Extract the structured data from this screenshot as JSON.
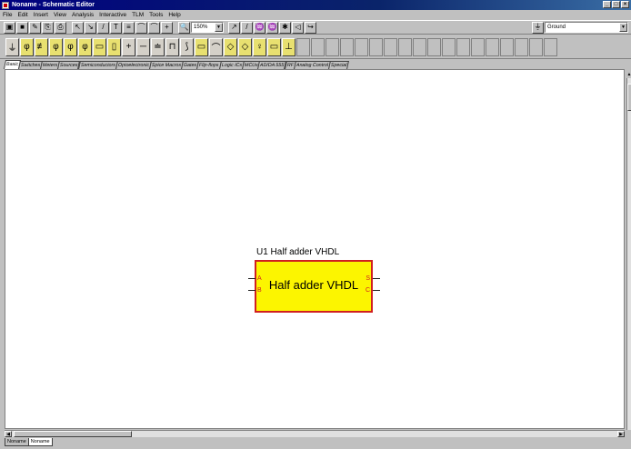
{
  "window": {
    "title": "Noname - Schematic Editor",
    "controls": [
      "_",
      "□",
      "×"
    ]
  },
  "menu": [
    "File",
    "Edit",
    "Insert",
    "View",
    "Analysis",
    "Interactive",
    "TLM",
    "Tools",
    "Help"
  ],
  "toolbar": {
    "buttons_a": [
      "▣",
      "■",
      "✎",
      "⎘",
      "⎙"
    ],
    "buttons_b": [
      "↖",
      "↘",
      "/",
      "T",
      "≡",
      "⌒",
      "⌒",
      "+"
    ],
    "zoom_value": "150%",
    "buttons_c": [
      "↗",
      "/",
      "♒",
      "♒",
      "✱",
      "◁",
      "↪"
    ],
    "ground_select": "Ground"
  },
  "parts": [
    "⏚",
    "φ",
    "≢",
    "φ",
    "φ",
    "φ",
    "▭",
    "▯",
    "+",
    "─",
    "≐",
    "⊓",
    "⟆",
    "▭",
    "⌒",
    "◇",
    "◇",
    "♀",
    "▭",
    "⊥"
  ],
  "tabs": [
    "Basic",
    "Switches",
    "Meters",
    "Sources",
    "Semiconductors",
    "Optoelectronic",
    "Spice Macros",
    "Gates",
    "Flip-flops",
    "Logic ICs",
    "MCUs",
    "AD/DA 555",
    "RF",
    "Analog Control",
    "Special"
  ],
  "document_tabs": [
    "Noname",
    "Noname"
  ],
  "component": {
    "label": "U1 Half adder VHDL",
    "name": "Half adder VHDL",
    "pins_left": [
      "A",
      "B"
    ],
    "pins_right": [
      "S",
      "C"
    ],
    "fill_color": "#fcf500",
    "border_color": "#d02020"
  }
}
